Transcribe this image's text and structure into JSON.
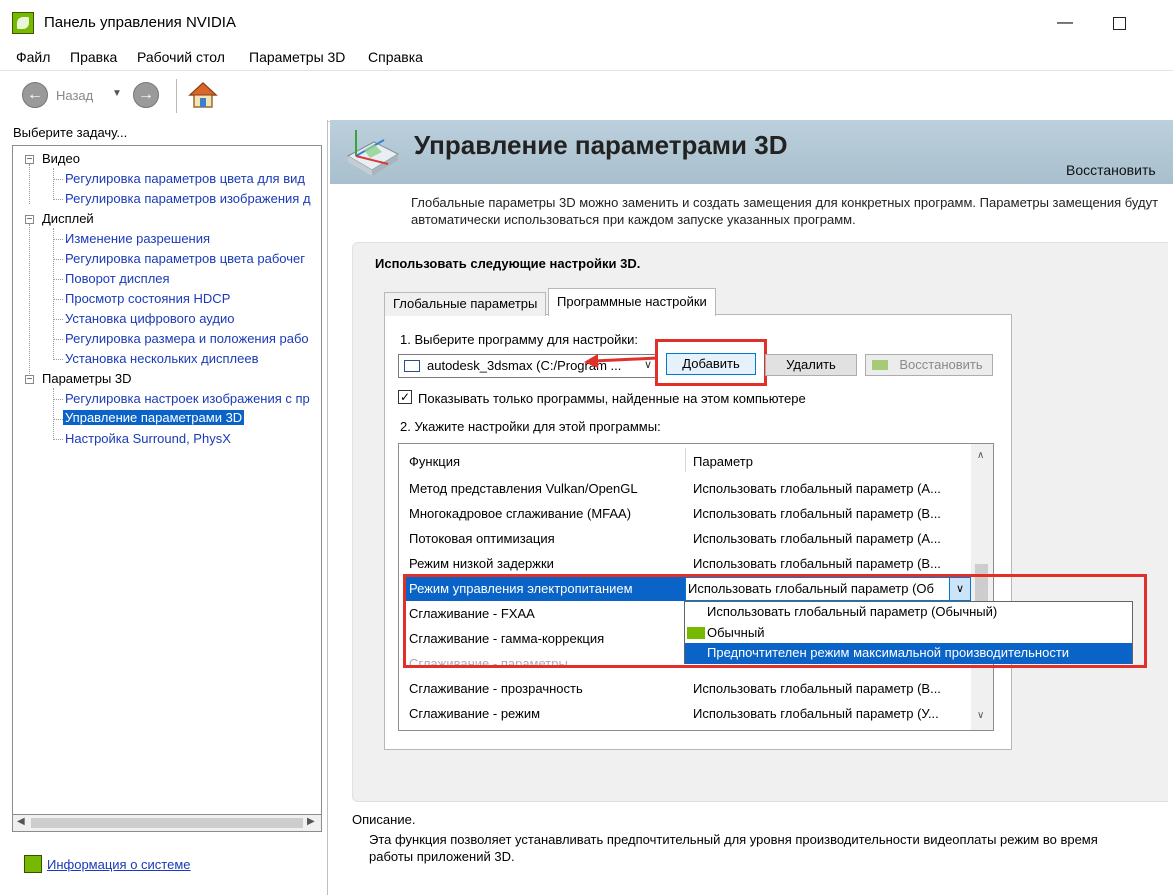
{
  "window": {
    "title": "Панель управления NVIDIA",
    "minimize": "—"
  },
  "menu": [
    "Файл",
    "Правка",
    "Рабочий стол",
    "Параметры 3D",
    "Справка"
  ],
  "toolbar": {
    "back_label": "Назад",
    "back_arrow": "←",
    "forward_arrow": "→",
    "dropdown": "▼"
  },
  "left": {
    "heading": "Выберите задачу...",
    "tree": [
      {
        "label": "Видео",
        "children": [
          "Регулировка параметров цвета для вид",
          "Регулировка параметров изображения д"
        ]
      },
      {
        "label": "Дисплей",
        "children": [
          "Изменение разрешения",
          "Регулировка параметров цвета рабочег",
          "Поворот дисплея",
          "Просмотр состояния HDCP",
          "Установка цифрового аудио",
          "Регулировка размера и положения рабо",
          "Установка нескольких дисплеев"
        ]
      },
      {
        "label": "Параметры 3D",
        "children": [
          "Регулировка настроек изображения с пр",
          "Управление параметрами 3D",
          "Настройка Surround, PhysX"
        ]
      }
    ],
    "sysinfo": "Информация о системе"
  },
  "header": {
    "title": "Управление параметрами 3D",
    "restore": "Восстановить"
  },
  "description_top": "Глобальные параметры 3D можно заменить и создать замещения для конкретных программ. Параметры замещения будут автоматически использоваться при каждом запуске указанных программ.",
  "group": {
    "heading": "Использовать следующие настройки 3D.",
    "tabs": [
      "Глобальные параметры",
      "Программные настройки"
    ],
    "step1": "1. Выберите программу для настройки:",
    "program_value": "autodesk_3dsmax (C:/Program ...",
    "buttons": {
      "add": "Добавить",
      "delete": "Удалить",
      "restore": "Восстановить"
    },
    "show_only": "Показывать только программы, найденные на этом компьютере",
    "show_only_checked": "✓",
    "step2": "2. Укажите настройки для этой программы:"
  },
  "grid": {
    "headers": [
      "Функция",
      "Параметр"
    ],
    "rows": [
      [
        "Метод представления Vulkan/OpenGL",
        "Использовать глобальный параметр (А..."
      ],
      [
        "Многокадровое сглаживание (MFAA)",
        "Использовать глобальный параметр (В..."
      ],
      [
        "Потоковая оптимизация",
        "Использовать глобальный параметр (А..."
      ],
      [
        "Режим низкой задержки",
        "Использовать глобальный параметр (В..."
      ],
      [
        "Режим управления электропитанием",
        "Использовать глобальный параметр (Об"
      ],
      [
        "Сглаживание - FXAA",
        ""
      ],
      [
        "Сглаживание - гамма-коррекция",
        ""
      ],
      [
        "Сглаживание - параметры",
        ""
      ],
      [
        "Сглаживание - прозрачность",
        "Использовать глобальный параметр (В..."
      ],
      [
        "Сглаживание - режим",
        "Использовать глобальный параметр (У..."
      ]
    ],
    "dropdown_options": [
      "Использовать глобальный параметр (Обычный)",
      "Обычный",
      "Предпочтителен режим максимальной производительности"
    ]
  },
  "description_bottom": {
    "heading": "Описание.",
    "body": "Эта функция позволяет устанавливать предпочтительный для уровня производительности видеоплаты режим во время работы приложений 3D."
  }
}
